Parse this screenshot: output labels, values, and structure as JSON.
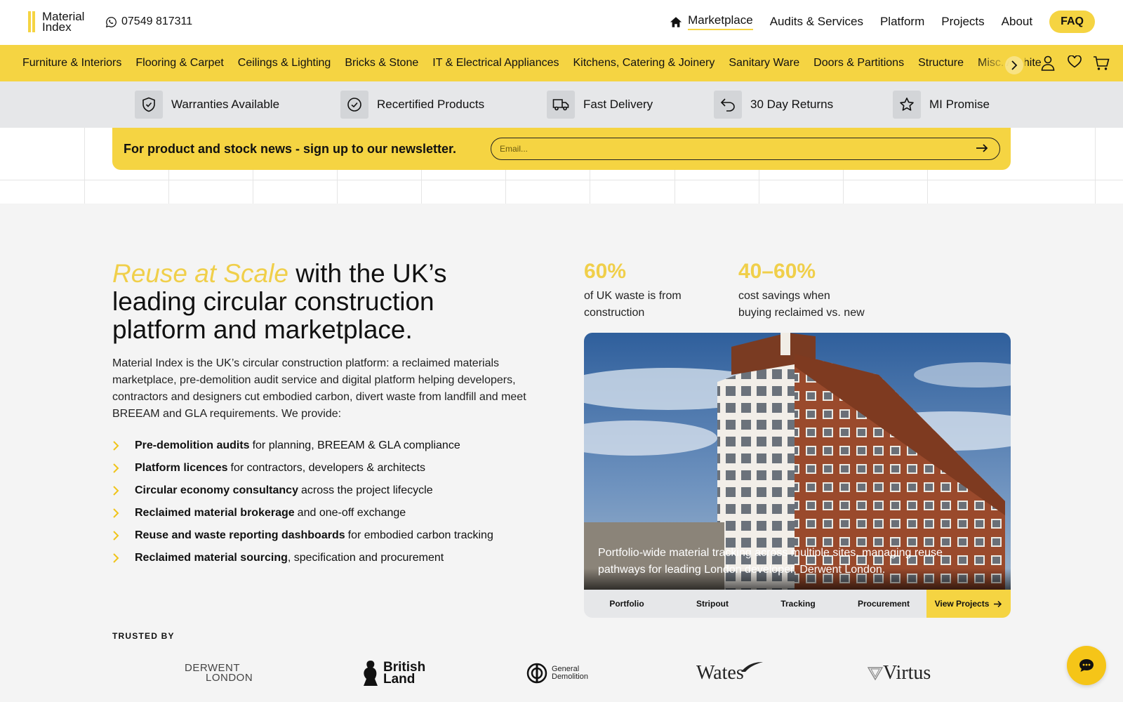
{
  "brand": {
    "logo_line1": "Material",
    "logo_line2": "Index",
    "phone": "07549 817311",
    "accent": "#f5d442"
  },
  "nav": {
    "items": [
      "Marketplace",
      "Audits & Services",
      "Platform",
      "Projects",
      "About"
    ],
    "faq": "FAQ"
  },
  "categories": [
    "Furniture & Interiors",
    "Flooring & Carpet",
    "Ceilings & Lighting",
    "Bricks & Stone",
    "IT & Electrical Appliances",
    "Kitchens, Catering & Joinery",
    "Sanitary Ware",
    "Doors & Partitions",
    "Structure",
    "Misc. Archite"
  ],
  "benefits": [
    "Warranties Available",
    "Recertified Products",
    "Fast Delivery",
    "30 Day Returns",
    "MI Promise"
  ],
  "newsletter": {
    "text": "For product and stock news - sign up to our newsletter.",
    "placeholder": "Email..."
  },
  "hero": {
    "title_highlight": "Reuse at Scale",
    "title_rest": " with the UK’s leading circular construction platform and marketplace.",
    "intro": "Material Index is the UK’s circular construction platform: a reclaimed materials marketplace, pre-demolition audit service and digital platform helping developers, contractors and designers cut embodied carbon, divert waste from landfill and meet BREEAM and GLA requirements. We provide:",
    "services": [
      {
        "bold": "Pre-demolition audits",
        "rest": "for planning, BREEAM & GLA compliance"
      },
      {
        "bold": "Platform licences",
        "rest": "for contractors, developers & architects"
      },
      {
        "bold": "Circular economy consultancy",
        "rest": "across the project lifecycle"
      },
      {
        "bold": "Reclaimed material brokerage",
        "rest": "and one-off exchange"
      },
      {
        "bold": "Reuse and waste reporting dashboards",
        "rest": "for embodied carbon tracking"
      },
      {
        "bold": "Reclaimed material sourcing",
        "rest": ", specification and procurement"
      }
    ]
  },
  "stats": [
    {
      "value": "60%",
      "label_line1": "of UK waste is from",
      "label_line2": "construction"
    },
    {
      "value": "40–60%",
      "label_line1": "cost savings when",
      "label_line2": "buying reclaimed vs. new"
    }
  ],
  "project": {
    "caption": "Portfolio-wide material tracking across multiple sites, managing reuse pathways for leading London developer, Derwent London.",
    "tabs": [
      "Portfolio",
      "Stripout",
      "Tracking",
      "Procurement"
    ],
    "cta": "View Projects"
  },
  "trusted": {
    "heading": "TRUSTED BY",
    "logos": [
      {
        "line1": "DERWENT",
        "line2": "LONDON"
      },
      {
        "line1": "British",
        "line2": "Land"
      },
      {
        "line1": "General",
        "line2": "Demolition"
      },
      {
        "name": "Wates"
      },
      {
        "name": "Virtus"
      }
    ]
  }
}
